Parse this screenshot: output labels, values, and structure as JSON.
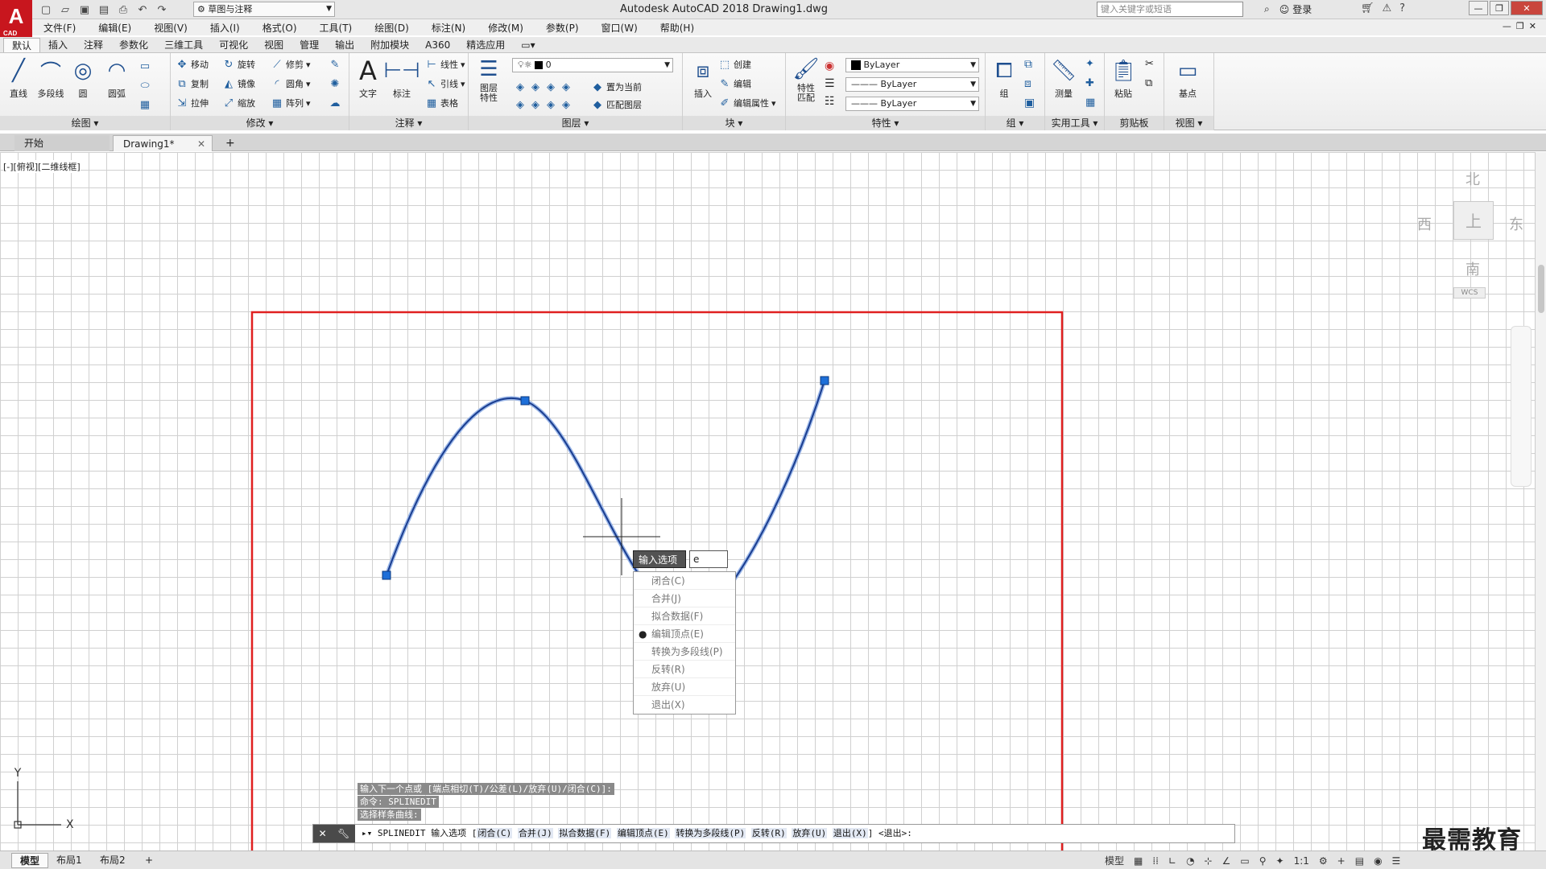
{
  "title_bar": {
    "title": "Autodesk AutoCAD 2018    Drawing1.dwg",
    "workspace": "草图与注释",
    "search_placeholder": "键入关键字或短语",
    "login": "登录",
    "quick_access_icons": [
      "new-icon",
      "open-icon",
      "save-icon",
      "saveas-icon",
      "plot-icon",
      "undo-icon",
      "redo-icon"
    ]
  },
  "menu": [
    "文件(F)",
    "编辑(E)",
    "视图(V)",
    "插入(I)",
    "格式(O)",
    "工具(T)",
    "绘图(D)",
    "标注(N)",
    "修改(M)",
    "参数(P)",
    "窗口(W)",
    "帮助(H)"
  ],
  "ribbon_tabs": [
    "默认",
    "插入",
    "注释",
    "参数化",
    "三维工具",
    "可视化",
    "视图",
    "管理",
    "输出",
    "附加模块",
    "A360",
    "精选应用"
  ],
  "ribbon": {
    "draw": {
      "title": "绘图",
      "line": "直线",
      "polyline": "多段线",
      "circle": "圆",
      "arc": "圆弧"
    },
    "modify": {
      "title": "修改",
      "move": "移动",
      "rotate": "旋转",
      "trim": "修剪",
      "copy": "复制",
      "mirror": "镜像",
      "fillet": "圆角",
      "stretch": "拉伸",
      "scale": "缩放",
      "array": "阵列"
    },
    "annotation": {
      "title": "注释",
      "text": "文字",
      "dimension": "标注",
      "linear": "线性",
      "leader": "引线",
      "table": "表格"
    },
    "layers": {
      "title": "图层",
      "properties": "图层\n特性",
      "layer_value": "0",
      "set_current": "置为当前",
      "match_layer": "匹配图层"
    },
    "block": {
      "title": "块",
      "insert": "插入",
      "create": "创建",
      "edit": "编辑",
      "edit_attr": "编辑属性"
    },
    "properties": {
      "title": "特性",
      "match": "特性\n匹配",
      "color": "ByLayer",
      "linetype": "ByLayer",
      "lineweight": "ByLayer"
    },
    "group": {
      "title": "组",
      "group": "组"
    },
    "utilities": {
      "title": "实用工具",
      "measure": "测量"
    },
    "clipboard": {
      "title": "剪贴板",
      "paste": "粘贴"
    },
    "view": {
      "title": "视图",
      "base": "基点"
    }
  },
  "file_tabs": {
    "start": "开始",
    "drawing": "Drawing1*"
  },
  "viewport_label": "[-][俯视][二维线框]",
  "viewcube": {
    "north": "北",
    "south": "南",
    "east": "东",
    "west": "西",
    "top": "上",
    "wcs": "WCS"
  },
  "popup": {
    "label": "输入选项",
    "input_value": "e",
    "options": [
      {
        "text": "闭合(C)",
        "selected": false
      },
      {
        "text": "合并(J)",
        "selected": false
      },
      {
        "text": "拟合数据(F)",
        "selected": false
      },
      {
        "text": "编辑顶点(E)",
        "selected": true
      },
      {
        "text": "转换为多段线(P)",
        "selected": false
      },
      {
        "text": "反转(R)",
        "selected": false
      },
      {
        "text": "放弃(U)",
        "selected": false
      },
      {
        "text": "退出(X)",
        "selected": false
      }
    ]
  },
  "command_history": [
    "输入下一个点或 [端点相切(T)/公差(L)/放弃(U)/闭合(C)]:",
    "命令: SPLINEDIT",
    "选择样条曲线:"
  ],
  "command_line": {
    "prefix": "SPLINEDIT 输入选项 [",
    "options": [
      "闭合(C)",
      "合并(J)",
      "拟合数据(F)",
      "编辑顶点(E)",
      "转换为多段线(P)",
      "反转(R)",
      "放弃(U)",
      "退出(X)"
    ],
    "suffix": "] <退出>:"
  },
  "layout_tabs": [
    "模型",
    "布局1",
    "布局2"
  ],
  "status": {
    "model": "模型",
    "scale": "1:1"
  },
  "watermark": "最需教育",
  "colors": {
    "spline": "#1a3d8f",
    "grip": "#1e6fd8",
    "frame": "#e02020"
  }
}
